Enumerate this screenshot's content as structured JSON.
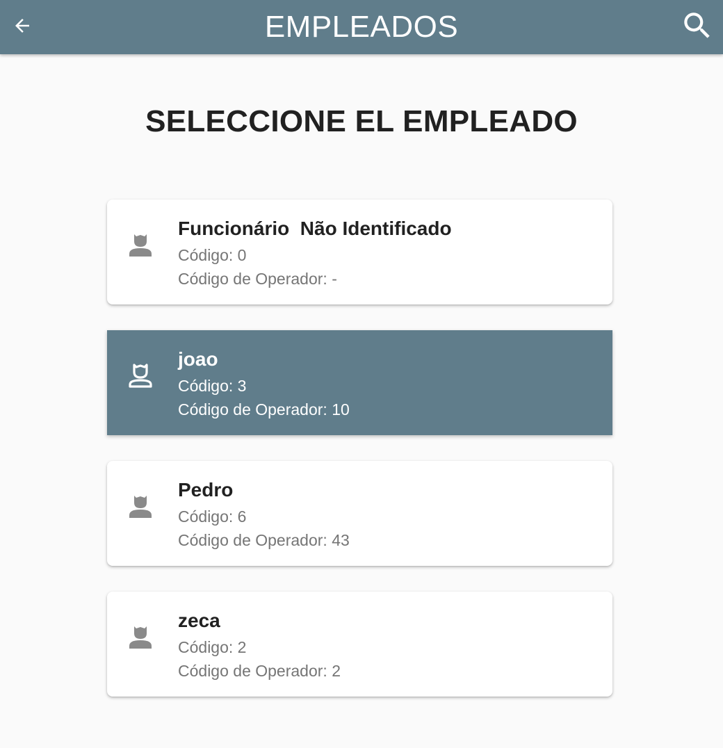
{
  "appbar": {
    "title": "EMPLEADOS",
    "back_icon": "arrow-left-icon",
    "search_icon": "search-icon",
    "color": "#607d8b"
  },
  "heading": "SELECCIONE EL EMPLEADO",
  "employees": [
    {
      "name": "Funcionário  Não Identificado",
      "code_text": "Código: 0",
      "operator_text": "Código de Operador: -",
      "selected": false
    },
    {
      "name": "joao",
      "code_text": "Código: 3",
      "operator_text": "Código de Operador: 10",
      "selected": true
    },
    {
      "name": "Pedro",
      "code_text": "Código: 6",
      "operator_text": "Código de Operador: 43",
      "selected": false
    },
    {
      "name": "zeca",
      "code_text": "Código: 2",
      "operator_text": "Código de Operador: 2",
      "selected": false
    }
  ],
  "colors": {
    "selected_card": "#607d8b",
    "avatar_default": "#8a8a8a",
    "avatar_selected": "#ffffff"
  }
}
